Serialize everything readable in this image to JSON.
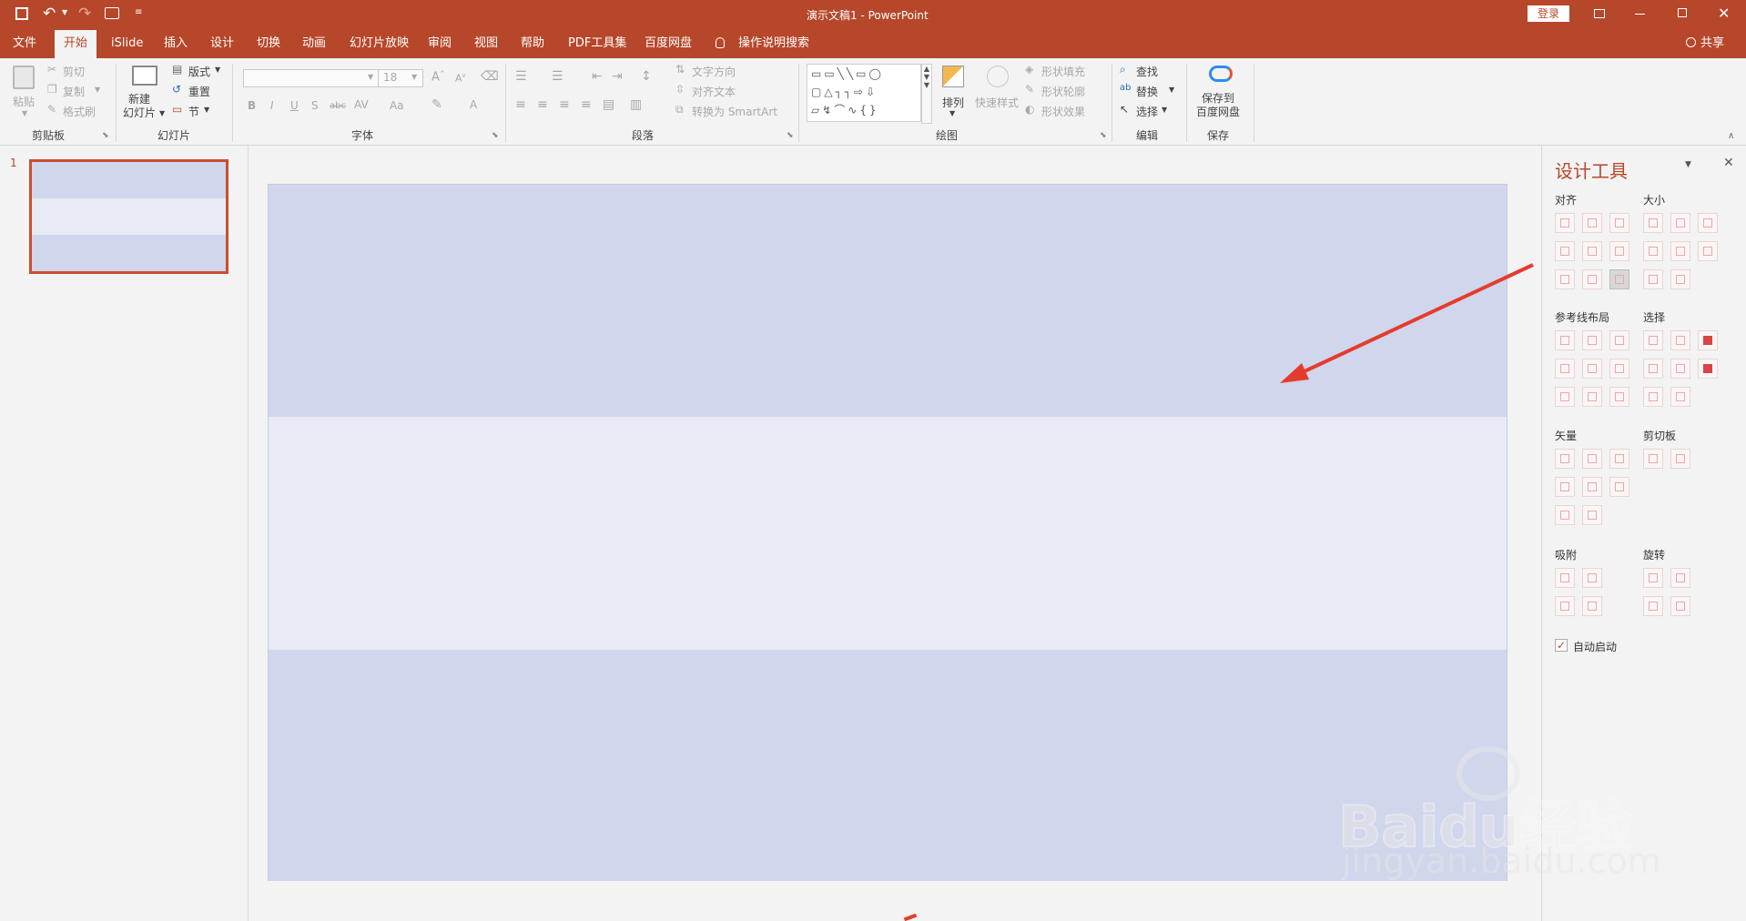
{
  "app": {
    "title": "演示文稿1 - PowerPoint",
    "login": "登录",
    "share": "共享"
  },
  "tabs": [
    "文件",
    "开始",
    "iSlide",
    "插入",
    "设计",
    "切换",
    "动画",
    "幻灯片放映",
    "审阅",
    "视图",
    "帮助",
    "PDF工具集",
    "百度网盘"
  ],
  "tell_me": "操作说明搜索",
  "ribbon": {
    "clipboard": {
      "paste": "粘贴",
      "cut": "剪切",
      "copy": "复制",
      "format_painter": "格式刷",
      "label": "剪贴板"
    },
    "slides": {
      "new_slide": "新建\n幻灯片",
      "layout": "版式",
      "reset": "重置",
      "section": "节",
      "label": "幻灯片"
    },
    "font": {
      "font_size": "18",
      "label": "字体"
    },
    "paragraph": {
      "text_direction": "文字方向",
      "align_text": "对齐文本",
      "smartart": "转换为 SmartArt",
      "label": "段落"
    },
    "drawing": {
      "arrange": "排列",
      "quick_styles": "快速样式",
      "shape_fill": "形状填充",
      "shape_outline": "形状轮廓",
      "shape_effects": "形状效果",
      "label": "绘图"
    },
    "editing": {
      "find": "查找",
      "replace": "替换",
      "select": "选择",
      "label": "编辑"
    },
    "save": {
      "save_to": "保存到\n百度网盘",
      "label": "保存"
    }
  },
  "thumbnail": {
    "number": "1"
  },
  "pane": {
    "title": "设计工具",
    "sections": {
      "align": "对齐",
      "size": "大小",
      "guides": "参考线布局",
      "select": "选择",
      "vector": "矢量",
      "clipboard": "剪切板",
      "snap": "吸附",
      "rotate": "旋转"
    },
    "auto_start": "自动启动"
  },
  "watermark": {
    "brand": "Baidu经验",
    "url": "jingyan.baidu.com"
  },
  "colors": {
    "accent": "#b7472a",
    "slide_band_dark": "#d0d6eb",
    "slide_band_light": "#e8ebf5"
  }
}
